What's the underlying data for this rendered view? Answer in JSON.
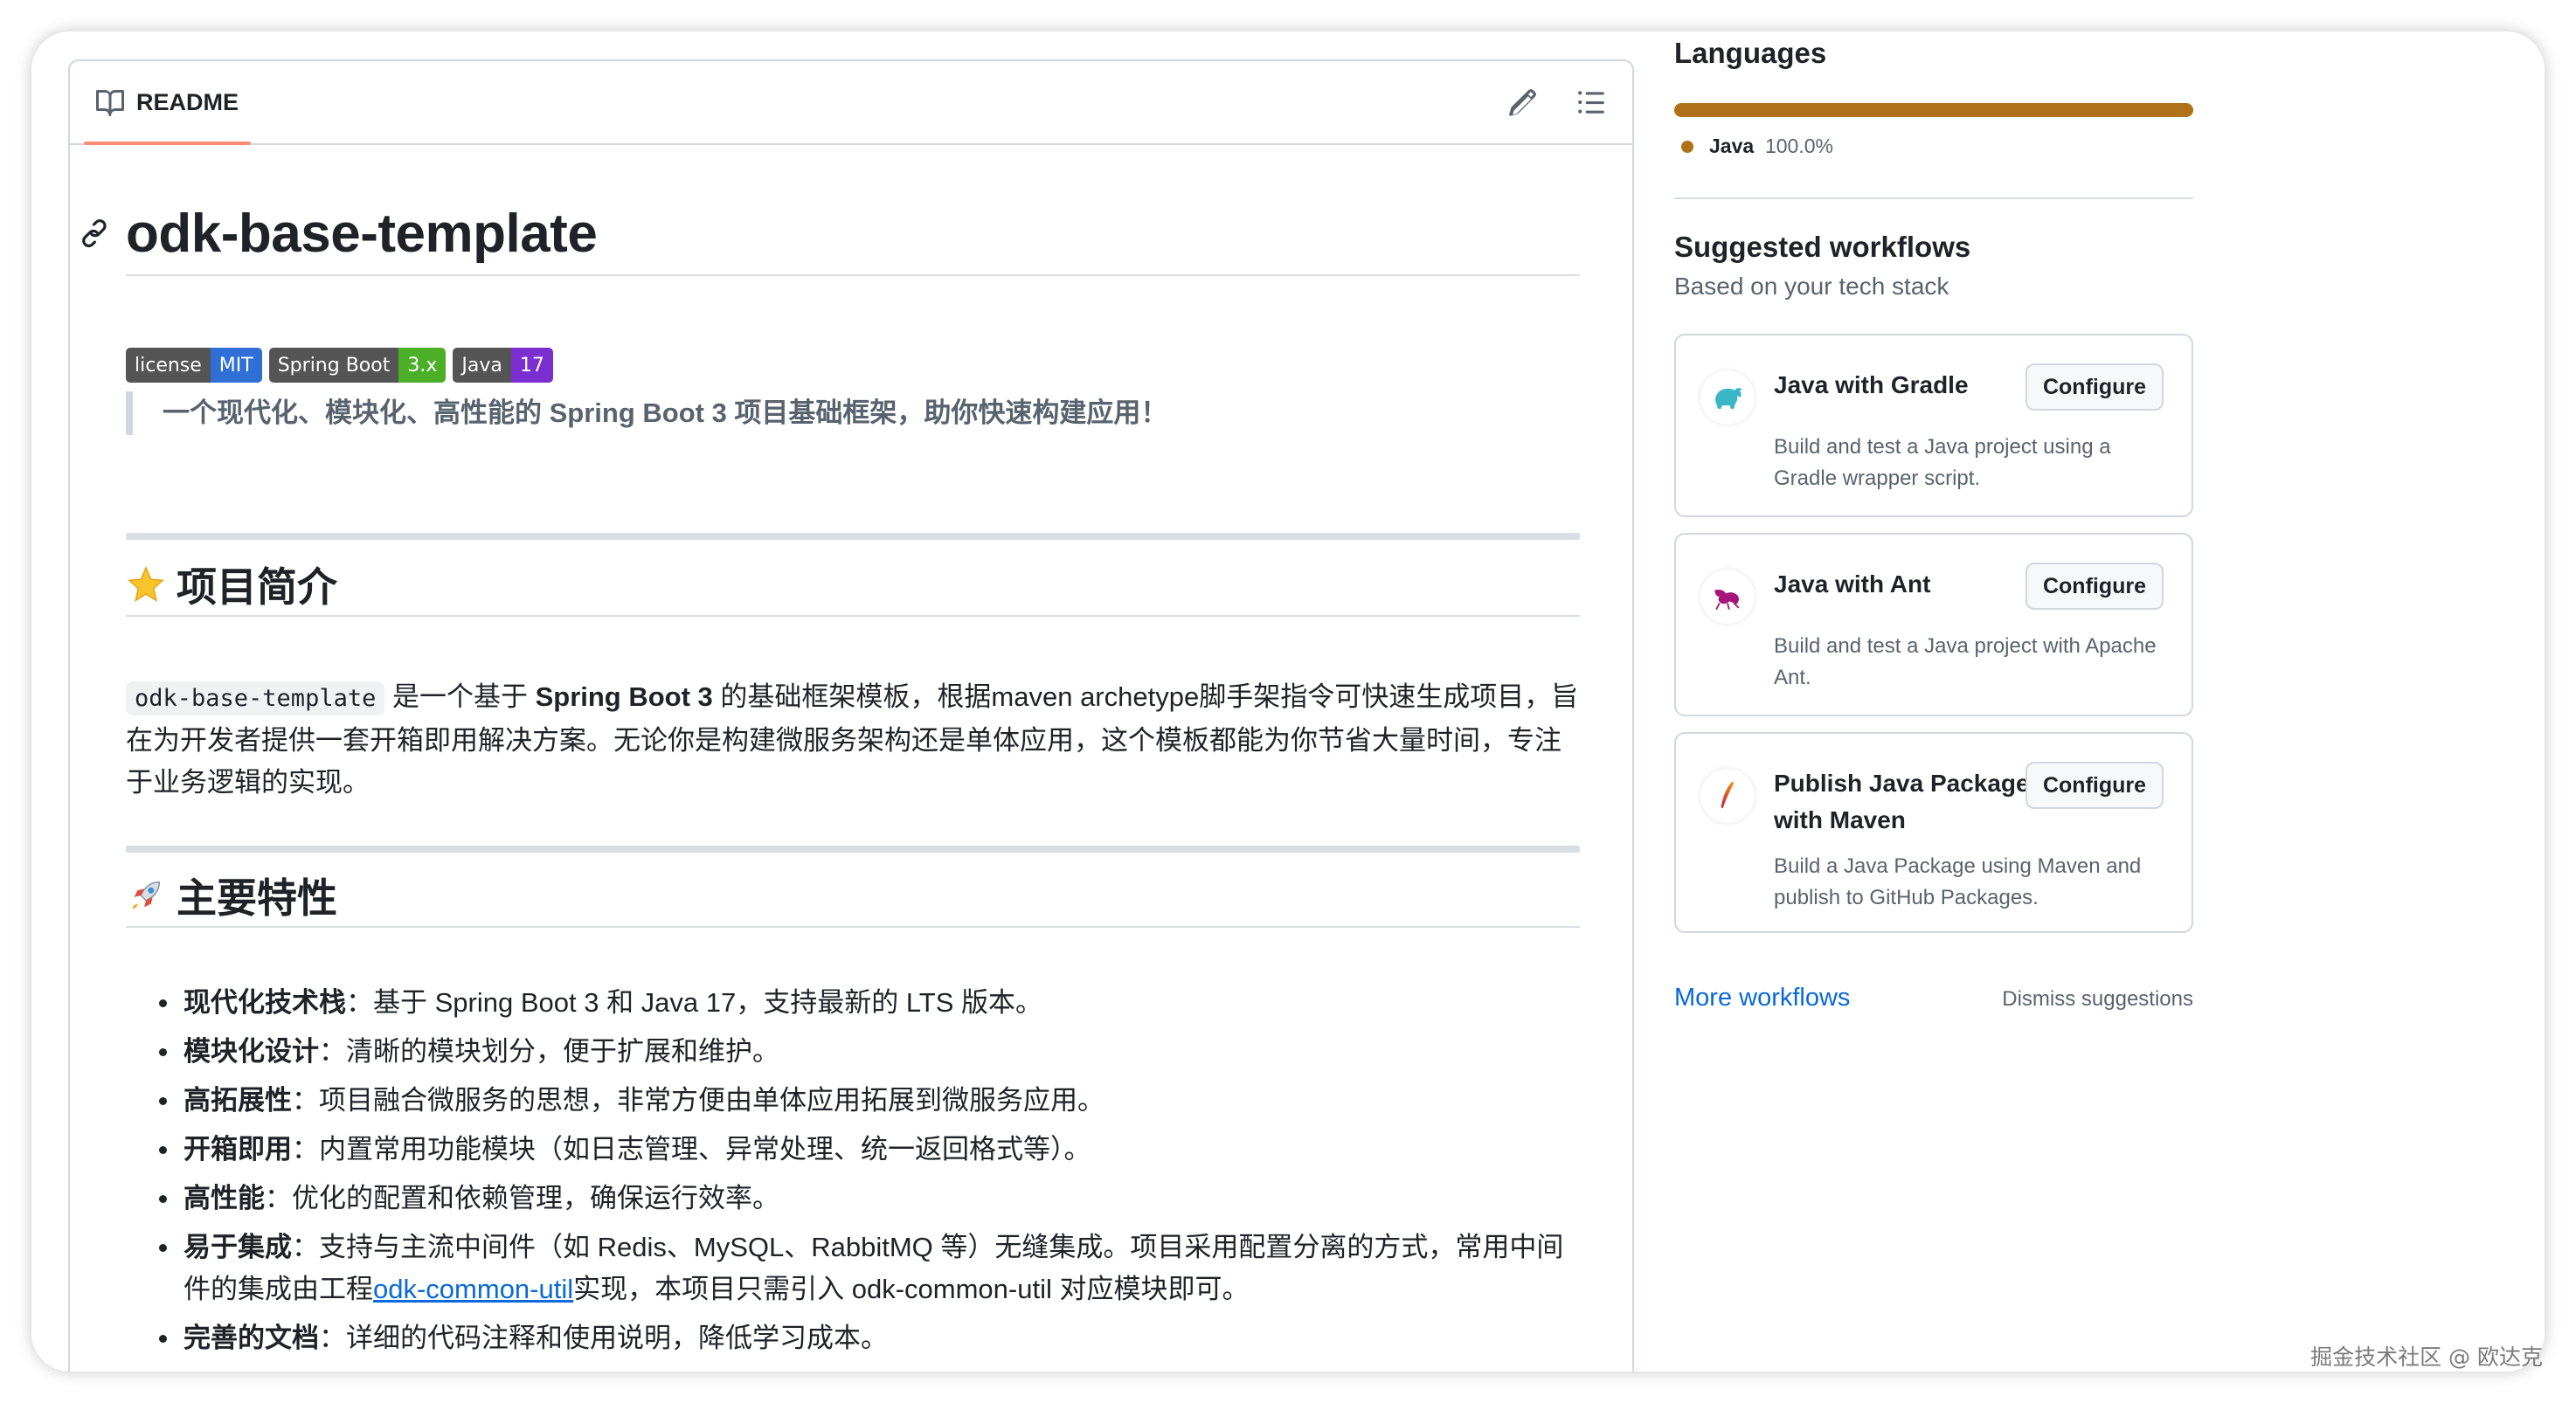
{
  "readme": {
    "tab_label": "README",
    "title": "odk-base-template",
    "badges": [
      {
        "left": "license",
        "right": "MIT",
        "color": "#2f6fd6"
      },
      {
        "left": "Spring Boot",
        "right": "3.x",
        "color": "#4caf28"
      },
      {
        "left": "Java",
        "right": "17",
        "color": "#7b2fd0"
      }
    ],
    "quote": "一个现代化、模块化、高性能的 Spring Boot 3 项目基础框架，助你快速构建应用！",
    "intro_heading": "项目简介",
    "intro": {
      "code": "odk-base-template",
      "t1": " 是一个基于 ",
      "bold": "Spring Boot 3",
      "t2": " 的基础框架模板，根据maven archetype脚手架指令可快速生成项目，旨在为开发者提供一套开箱即用解决方案。无论你是构建微服务架构还是单体应用，这个模板都能为你节省大量时间，专注于业务逻辑的实现。"
    },
    "features_heading": "主要特性",
    "features": [
      {
        "bold": "现代化技术栈",
        "text": "：基于 Spring Boot 3 和 Java 17，支持最新的 LTS 版本。"
      },
      {
        "bold": "模块化设计",
        "text": "：清晰的模块划分，便于扩展和维护。"
      },
      {
        "bold": "高拓展性",
        "text": "：项目融合微服务的思想，非常方便由单体应用拓展到微服务应用。"
      },
      {
        "bold": "开箱即用",
        "text": "：内置常用功能模块（如日志管理、异常处理、统一返回格式等）。"
      },
      {
        "bold": "高性能",
        "text": "：优化的配置和依赖管理，确保运行效率。"
      },
      {
        "bold": "易于集成",
        "text": "：支持与主流中间件（如 Redis、MySQL、RabbitMQ 等）无缝集成。项目采用配置分离的方式，常用中间件的集成由工程",
        "link": "odk-common-util",
        "after": "实现，本项目只需引入 odk-common-util 对应模块即可。"
      },
      {
        "bold": "完善的文档",
        "text": "：详细的代码注释和使用说明，降低学习成本。"
      }
    ]
  },
  "sidebar": {
    "languages_heading": "Languages",
    "language_name": "Java",
    "language_pct": "100.0%",
    "workflows_heading": "Suggested workflows",
    "workflows_sub": "Based on your tech stack",
    "cards": [
      {
        "title": "Java with Gradle",
        "desc": "Build and test a Java project using a Gradle wrapper script.",
        "button": "Configure"
      },
      {
        "title": "Java with Ant",
        "desc": "Build and test a Java project with Apache Ant.",
        "button": "Configure"
      },
      {
        "title": "Publish Java Package with Maven",
        "desc": "Build a Java Package using Maven and publish to GitHub Packages.",
        "button": "Configure"
      }
    ],
    "more_workflows": "More workflows",
    "dismiss": "Dismiss suggestions"
  },
  "watermark": "掘金技术社区 @ 欧达克",
  "colors": {
    "accent": "#0969da",
    "java": "#b07219",
    "tab_underline": "#fd8c73"
  }
}
